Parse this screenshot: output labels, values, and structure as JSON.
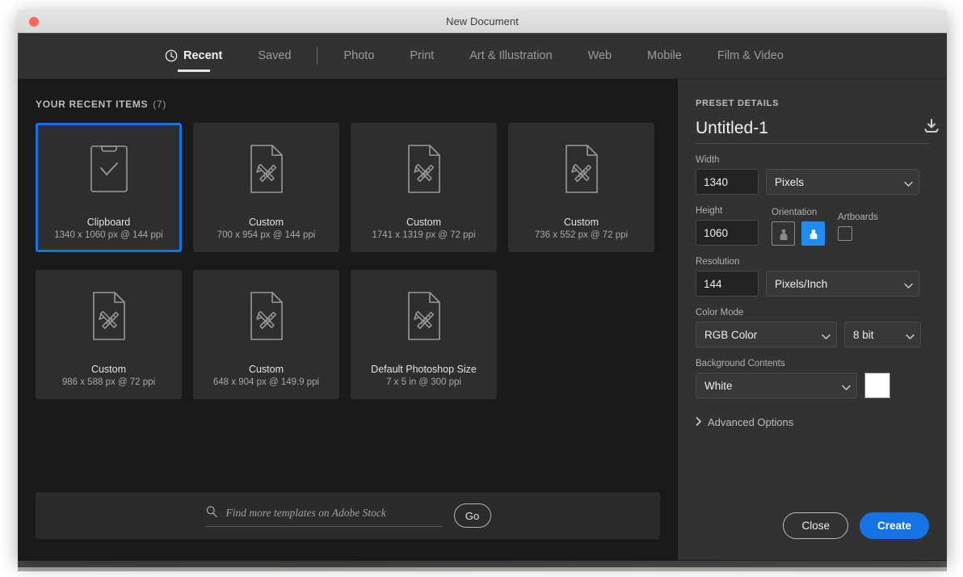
{
  "window": {
    "title": "New Document",
    "close_dot": "close-traffic-light"
  },
  "tabs": [
    {
      "label": "Recent",
      "icon": "clock-icon",
      "active": true
    },
    {
      "label": "Saved",
      "active": false
    },
    {
      "label": "Photo",
      "active": false
    },
    {
      "label": "Print",
      "active": false
    },
    {
      "label": "Art & Illustration",
      "active": false
    },
    {
      "label": "Web",
      "active": false
    },
    {
      "label": "Mobile",
      "active": false
    },
    {
      "label": "Film & Video",
      "active": false
    }
  ],
  "recent": {
    "heading": "YOUR RECENT ITEMS",
    "count": "(7)",
    "items": [
      {
        "name": "Clipboard",
        "meta": "1340 x 1060 px @ 144 ppi",
        "icon": "clipboard-check-icon",
        "selected": true
      },
      {
        "name": "Custom",
        "meta": "700 x 954 px @ 144 ppi",
        "icon": "document-pencil-ruler-icon",
        "selected": false
      },
      {
        "name": "Custom",
        "meta": "1741 x 1319 px @ 72 ppi",
        "icon": "document-pencil-ruler-icon",
        "selected": false
      },
      {
        "name": "Custom",
        "meta": "736 x 552 px @ 72 ppi",
        "icon": "document-pencil-ruler-icon",
        "selected": false
      },
      {
        "name": "Custom",
        "meta": "986 x 588 px @ 72 ppi",
        "icon": "document-pencil-ruler-icon",
        "selected": false
      },
      {
        "name": "Custom",
        "meta": "648 x 904 px @ 149.9 ppi",
        "icon": "document-pencil-ruler-icon",
        "selected": false
      },
      {
        "name": "Default Photoshop Size",
        "meta": "7 x 5 in @ 300 ppi",
        "icon": "document-pencil-ruler-icon",
        "selected": false
      }
    ]
  },
  "stock": {
    "placeholder": "Find more templates on Adobe Stock",
    "value": "",
    "go_label": "Go",
    "search_icon": "search-icon"
  },
  "preset": {
    "heading": "PRESET DETAILS",
    "doc_name": "Untitled-1",
    "doc_name_placeholder": "Untitled-1",
    "save_preset_icon": "save-preset-icon",
    "width_label": "Width",
    "width_value": "1340",
    "width_unit": "Pixels",
    "height_label": "Height",
    "height_value": "1060",
    "orientation_label": "Orientation",
    "orientation_portrait_icon": "orientation-portrait-icon",
    "orientation_landscape_icon": "orientation-landscape-icon",
    "orientation_selected": "landscape",
    "artboards_label": "Artboards",
    "artboards_checked": false,
    "resolution_label": "Resolution",
    "resolution_value": "144",
    "resolution_unit": "Pixels/Inch",
    "color_mode_label": "Color Mode",
    "color_mode_value": "RGB Color",
    "color_depth_value": "8 bit",
    "background_label": "Background Contents",
    "background_value": "White",
    "background_swatch": "#ffffff",
    "advanced_label": "Advanced Options",
    "advanced_chevron_icon": "chevron-right-icon"
  },
  "buttons": {
    "close_label": "Close",
    "create_label": "Create"
  },
  "colors": {
    "accent": "#1473e6",
    "selection": "#1473e6",
    "left_panel_bg": "#1a1a1a",
    "right_panel_bg": "#323232",
    "card_bg": "#2e2e2e",
    "titlebar_bg": "#dddddd",
    "close_dot": "#ff6459"
  }
}
